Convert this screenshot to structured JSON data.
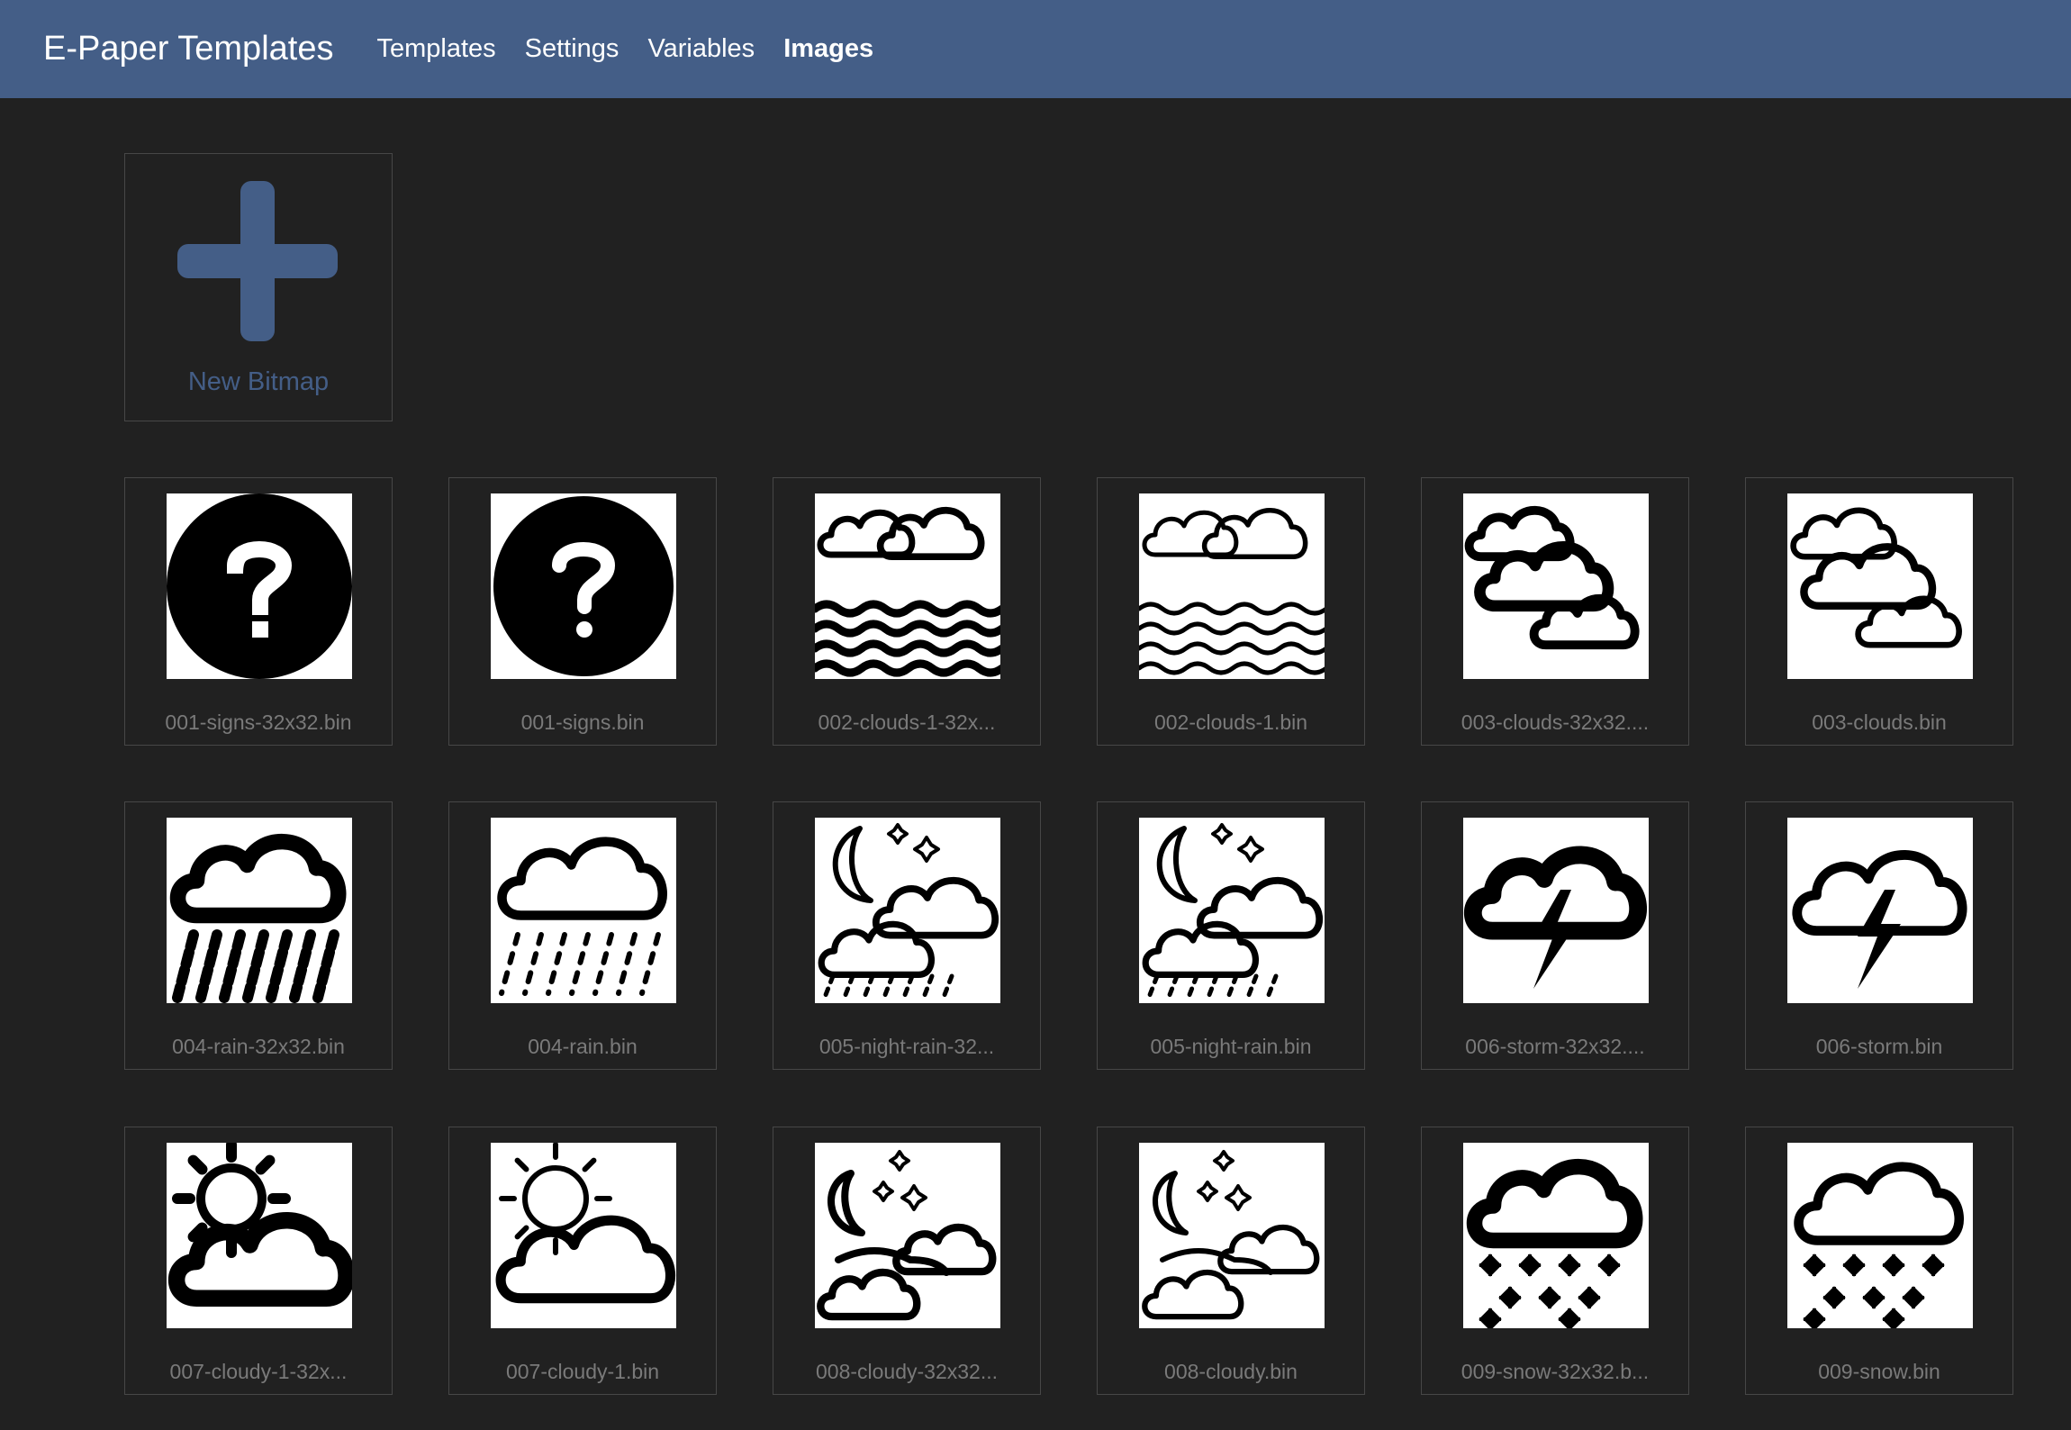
{
  "brand": "E-Paper Templates",
  "nav": [
    "Templates",
    "Settings",
    "Variables",
    "Images"
  ],
  "active_nav": "Images",
  "new_bitmap_label": "New Bitmap",
  "colors": {
    "navbar": "#445e87",
    "background": "#212121",
    "accent": "#445e87"
  },
  "images": [
    {
      "name": "001-signs-32x32.bin",
      "icon": "question-icon"
    },
    {
      "name": "001-signs.bin",
      "icon": "question-icon"
    },
    {
      "name": "002-clouds-1-32x...",
      "icon": "clouds-waves-icon"
    },
    {
      "name": "002-clouds-1.bin",
      "icon": "clouds-waves-icon"
    },
    {
      "name": "003-clouds-32x32....",
      "icon": "clouds-icon"
    },
    {
      "name": "003-clouds.bin",
      "icon": "clouds-icon"
    },
    {
      "name": "004-rain-32x32.bin",
      "icon": "rain-icon"
    },
    {
      "name": "004-rain.bin",
      "icon": "rain-icon"
    },
    {
      "name": "005-night-rain-32...",
      "icon": "night-rain-icon"
    },
    {
      "name": "005-night-rain.bin",
      "icon": "night-rain-icon"
    },
    {
      "name": "006-storm-32x32....",
      "icon": "storm-icon"
    },
    {
      "name": "006-storm.bin",
      "icon": "storm-icon"
    },
    {
      "name": "007-cloudy-1-32x...",
      "icon": "sun-cloud-icon"
    },
    {
      "name": "007-cloudy-1.bin",
      "icon": "sun-cloud-icon"
    },
    {
      "name": "008-cloudy-32x32...",
      "icon": "night-cloudy-icon"
    },
    {
      "name": "008-cloudy.bin",
      "icon": "night-cloudy-icon"
    },
    {
      "name": "009-snow-32x32.b...",
      "icon": "snow-icon"
    },
    {
      "name": "009-snow.bin",
      "icon": "snow-icon"
    }
  ]
}
